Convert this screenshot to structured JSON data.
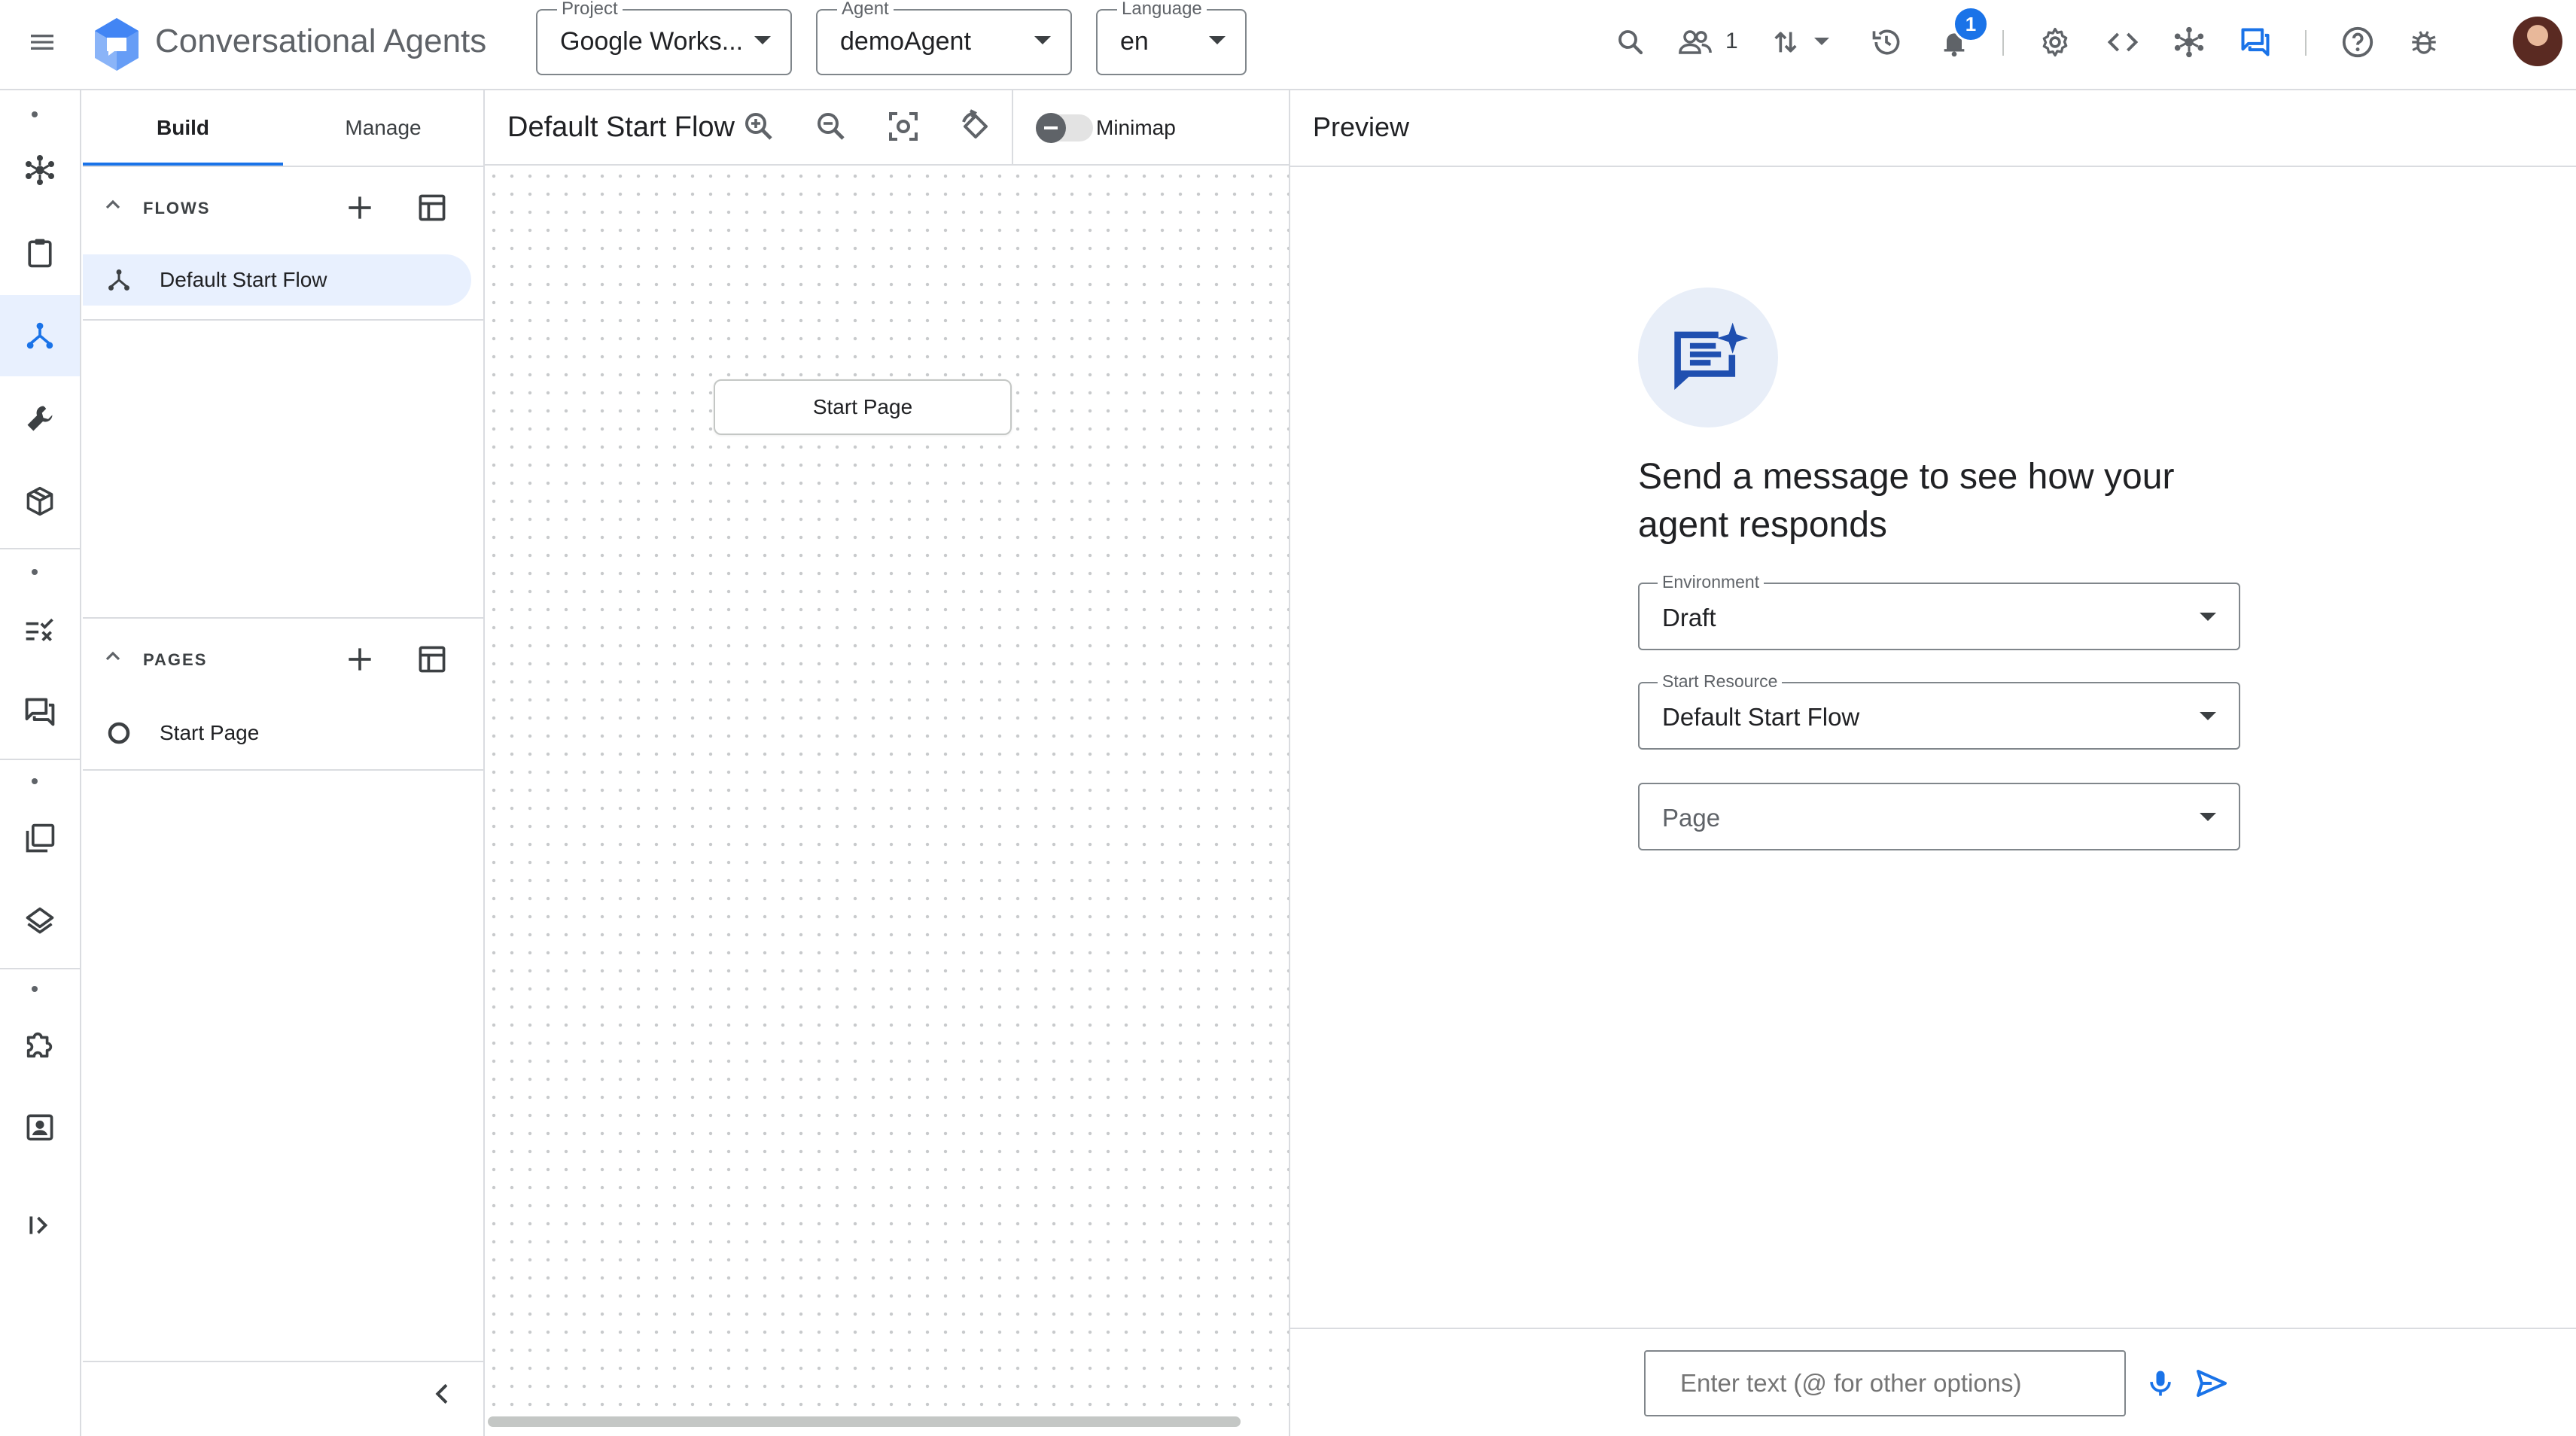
{
  "app": {
    "title": "Conversational Agents",
    "accent_color": "#1a73e8",
    "project": {
      "label": "Project",
      "value": "Google Works..."
    },
    "agent": {
      "label": "Agent",
      "value": "demoAgent"
    },
    "language": {
      "label": "Language",
      "value": "en"
    },
    "toolbar_icons": [
      "search-icon",
      "people-icon",
      "swap-vert-icon",
      "history-icon",
      "notifications-icon",
      "settings-icon",
      "code-icon",
      "hub-icon",
      "chat-icon",
      "help-icon",
      "bug-icon"
    ],
    "people_count": "1",
    "notification_badge": "1"
  },
  "rail": {
    "icons": [
      "flows-hub-icon",
      "clipboard-icon",
      "flow-tree-icon",
      "wrench-icon",
      "package-icon",
      "checklist-icon",
      "forum-icon",
      "library-icon",
      "layers-icon",
      "puzzle-icon",
      "contact-icon",
      "expand-icon"
    ],
    "active": "flow-tree-icon"
  },
  "build": {
    "tabs": [
      {
        "label": "Build",
        "active": true
      },
      {
        "label": "Manage",
        "active": false
      }
    ],
    "flows": {
      "title": "FLOWS",
      "items": [
        {
          "label": "Default Start Flow",
          "selected": true
        }
      ]
    },
    "pages": {
      "title": "PAGES",
      "items": [
        {
          "label": "Start Page"
        }
      ]
    }
  },
  "canvas": {
    "title": "Default Start Flow",
    "minimap_label": "Minimap",
    "minimap_on": false,
    "node_label": "Start Page"
  },
  "preview": {
    "title": "Preview",
    "hero_text": "Send a message to see how your agent responds",
    "environment": {
      "label": "Environment",
      "value": "Draft"
    },
    "start_resource": {
      "label": "Start Resource",
      "value": "Default Start Flow"
    },
    "page": {
      "placeholder": "Page"
    },
    "input_placeholder": "Enter text (@ for other options)"
  }
}
